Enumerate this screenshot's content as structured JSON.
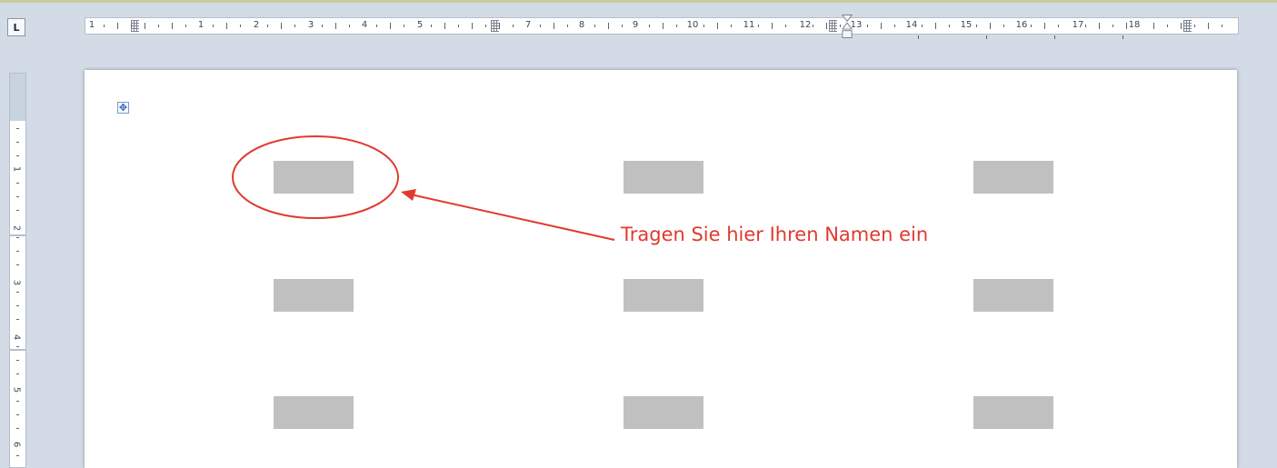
{
  "ruler": {
    "tab_selector_label": "L",
    "horizontal_labels": [
      "1",
      "1",
      "2",
      "3",
      "4",
      "5",
      "7",
      "8",
      "9",
      "10",
      "11",
      "12",
      "13",
      "14",
      "15",
      "16",
      "17",
      "18"
    ],
    "vertical_labels": [
      "1",
      "2",
      "3",
      "4",
      "5",
      "6"
    ]
  },
  "table": {
    "move_handle_icon": "table-move-handle-icon",
    "rows": 3,
    "columns": 3
  },
  "annotation": {
    "callout_text": "Tragen Sie hier Ihren Namen ein",
    "color": "#e03a2f"
  },
  "colors": {
    "background": "#d3dbe6",
    "field_fill": "#c0c0c0",
    "page": "#ffffff"
  }
}
